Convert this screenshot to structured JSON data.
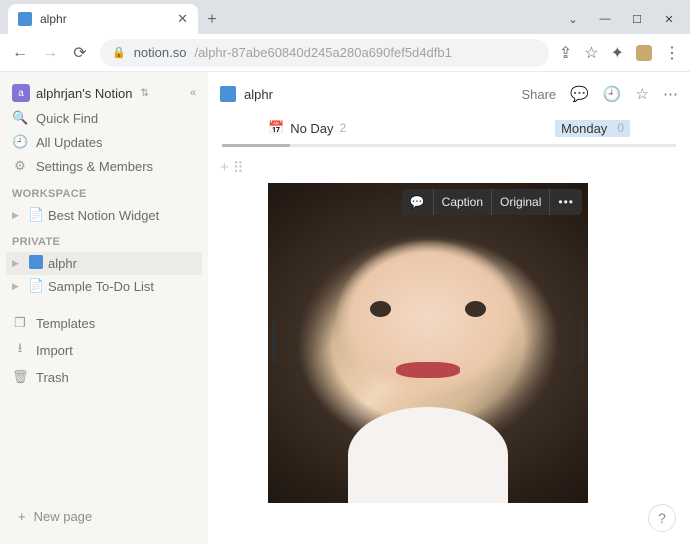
{
  "browser": {
    "tab_title": "alphr",
    "url_host": "notion.so",
    "url_path": "/alphr-87abe60840d245a280a690fef5d4dfb1"
  },
  "sidebar": {
    "workspace_name": "alphrjan's Notion",
    "quick_find": "Quick Find",
    "all_updates": "All Updates",
    "settings": "Settings & Members",
    "section_workspace": "WORKSPACE",
    "section_private": "PRIVATE",
    "pages_workspace": [
      {
        "icon": "📄",
        "label": "Best Notion Widget"
      }
    ],
    "pages_private": [
      {
        "icon": "blue",
        "label": "alphr"
      },
      {
        "icon": "📄",
        "label": "Sample To-Do List"
      }
    ],
    "templates": "Templates",
    "import": "Import",
    "trash": "Trash",
    "new_page": "New page"
  },
  "topbar": {
    "title": "alphr",
    "share": "Share"
  },
  "subtabs": {
    "tab1_icon": "📅",
    "tab1_label": "No Day",
    "tab1_count": "2",
    "tab2_label": "Monday",
    "tab2_count": "0"
  },
  "image_toolbar": {
    "caption": "Caption",
    "original": "Original"
  },
  "help": "?"
}
